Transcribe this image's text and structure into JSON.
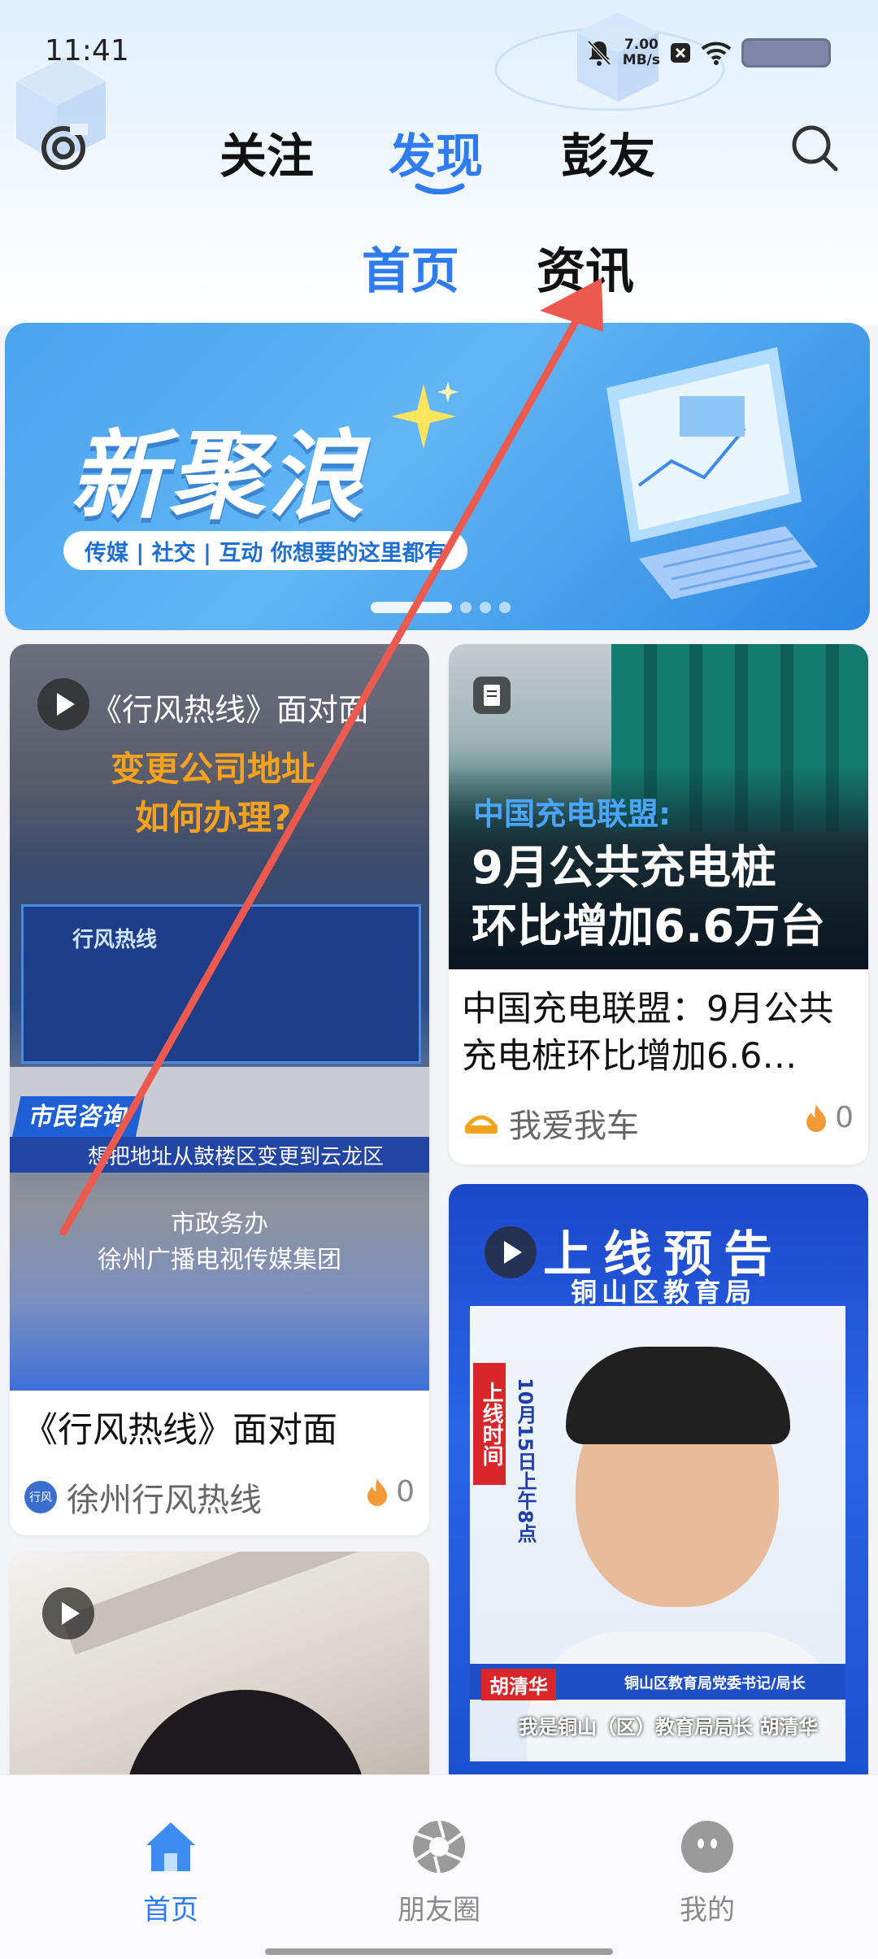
{
  "status_bar": {
    "time": "11:41",
    "net_speed_value": "7.00",
    "net_speed_unit": "MB/s"
  },
  "top_nav": {
    "tabs": [
      "关注",
      "发现",
      "彭友"
    ],
    "active_index": 1
  },
  "sub_tabs": [
    "首页",
    "资讯"
  ],
  "banner": {
    "title": "新聚浪",
    "subtitle": "传媒 | 社交 | 互动  你想要的这里都有"
  },
  "cards": {
    "left1": {
      "overlay_title": "《行风热线》面对面",
      "overlay_q1": "变更公司地址",
      "overlay_q2": "如何办理?",
      "screen_text": "行风热线",
      "bar_tag": "市民咨询",
      "bar_text": "想把地址从鼓楼区变更到云龙区",
      "caption1": "市政务办",
      "caption2": "徐州广播电视传媒集团",
      "title": "《行风热线》面对面",
      "source": "徐州行风热线",
      "heat": "0"
    },
    "right1": {
      "overlay_line1": "中国充电联盟:",
      "overlay_line2": "9月公共充电桩",
      "overlay_line3": "环比增加6.6万台",
      "title": "中国充电联盟：9月公共充电桩环比增加6.6…",
      "source": "我爱我车",
      "heat": "0"
    },
    "right2": {
      "overlay_title": "上线预告",
      "overlay_org": "铜山区教育局",
      "side_tag": "上线时间",
      "date_text": "10月15日上午8点",
      "name_tag": "胡清华",
      "role_tag": "铜山区教育局党委书记/局长",
      "caption": "我是铜山（区）教育局局长 胡清华"
    }
  },
  "bottom_nav": {
    "items": [
      "首页",
      "朋友圈",
      "我的"
    ],
    "active_index": 0
  },
  "colors": {
    "accent": "#2f7bf0",
    "annotation": "#ec5a4f"
  }
}
